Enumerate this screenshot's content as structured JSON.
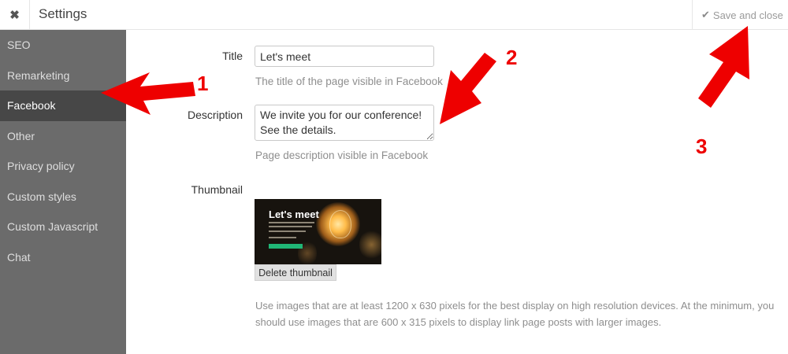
{
  "header": {
    "close_icon_glyph": "✖",
    "title": "Settings",
    "check_icon_glyph": "✔",
    "save_label": "Save and close"
  },
  "sidebar": {
    "items": [
      {
        "label": "SEO",
        "active": false
      },
      {
        "label": "Remarketing",
        "active": false
      },
      {
        "label": "Facebook",
        "active": true
      },
      {
        "label": "Other",
        "active": false
      },
      {
        "label": "Privacy policy",
        "active": false
      },
      {
        "label": "Custom styles",
        "active": false
      },
      {
        "label": "Custom Javascript",
        "active": false
      },
      {
        "label": "Chat",
        "active": false
      }
    ]
  },
  "form": {
    "title": {
      "label": "Title",
      "value": "Let's meet",
      "hint": "The title of the page visible in Facebook"
    },
    "description": {
      "label": "Description",
      "value": "We invite you for our conference!\nSee the details.",
      "hint": "Page description visible in Facebook"
    },
    "thumbnail": {
      "label": "Thumbnail",
      "image_title": "Let's meet",
      "delete_label": "Delete thumbnail",
      "note": "Use images that are at least 1200 x 630 pixels for the best display on high resolution devices. At the minimum, you should use images that are 600 x 315 pixels to display link page posts with larger images."
    }
  },
  "annotations": {
    "markers": [
      "1",
      "2",
      "3"
    ],
    "color": "#ee0000"
  },
  "colors": {
    "sidebar_bg": "#6b6b6b",
    "sidebar_active_bg": "#474747",
    "hint_text": "#8e8e8e"
  }
}
